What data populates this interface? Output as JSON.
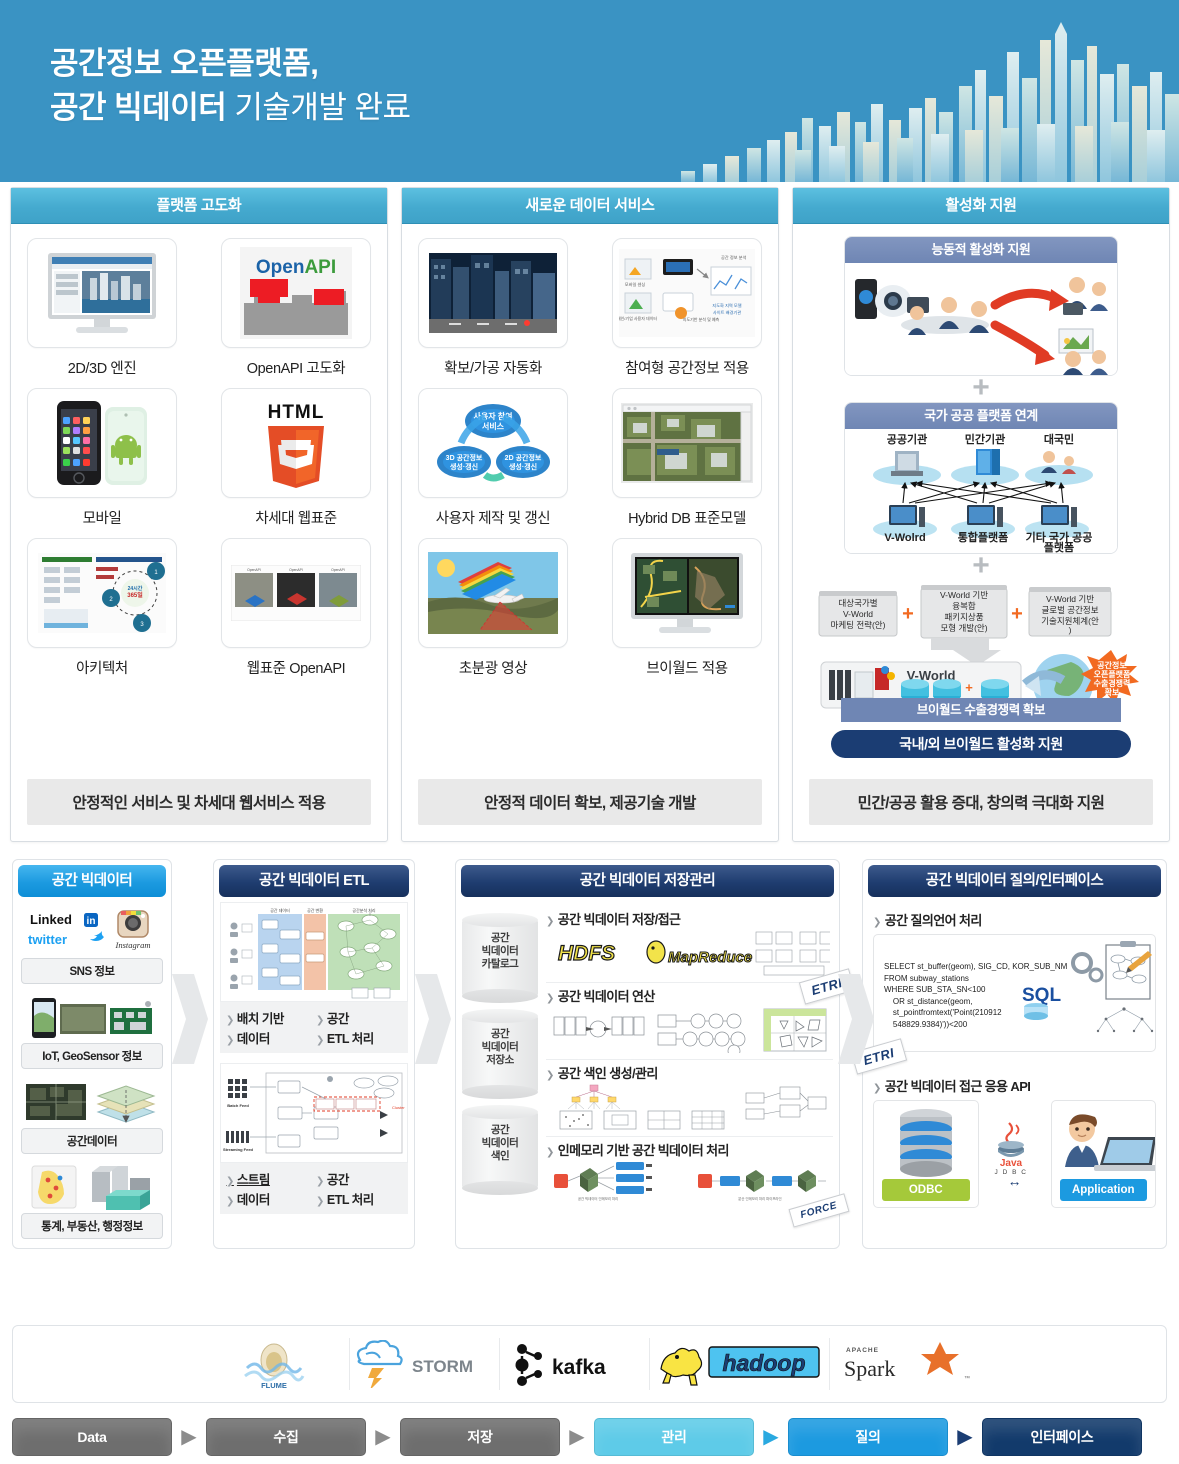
{
  "header": {
    "title_line1": "공간정보 오픈플랫폼,",
    "title_line2_bold": "공간 빅데이터",
    "title_line2_light": " 기술개발 완료",
    "bg_color": "#3a93c3",
    "graphic": "3d-city-skyline"
  },
  "panels": [
    {
      "title": "플랫폼 고도화",
      "tiles": [
        {
          "caption": "2D/3D 엔진",
          "icon": "desktop-monitor-3d-map"
        },
        {
          "caption": "OpenAPI 고도화",
          "icon": "openapi-logo"
        },
        {
          "caption": "모바일",
          "icon": "smartphones-ios-android"
        },
        {
          "caption": "차세대 웹표준",
          "icon": "html5-logo"
        },
        {
          "caption": "아키텍처",
          "icon": "architecture-diagram"
        },
        {
          "caption": "웹표준 OpenAPI",
          "icon": "webstandard-openapi-thumbnails"
        }
      ],
      "footer": "안정적인 서비스 및 차세대 웹서비스 적용"
    },
    {
      "title": "새로운 데이터 서비스",
      "tiles": [
        {
          "caption": "확보/가공 자동화",
          "icon": "city-street-photo"
        },
        {
          "caption": "참여형 공간정보 적용",
          "icon": "participatory-spatial-diagram"
        },
        {
          "caption": "사용자 제작 및 갱신",
          "icon": "cycle-diagram-user-service"
        },
        {
          "caption": "Hybrid DB 표준모델",
          "icon": "aerial-map-viewer"
        },
        {
          "caption": "초분광 영상",
          "icon": "hyperspectral-aircraft"
        },
        {
          "caption": "브이월드 적용",
          "icon": "monitor-vworld-map"
        }
      ],
      "footer": "안정적 데이터 확보, 제공기술 개발"
    },
    {
      "title": "활성화 지원",
      "blocks": [
        {
          "title": "능동적 활성화 지원",
          "icon": "people-meeting-devices"
        },
        {
          "title": "국가 공공 플랫폼 연계",
          "top_nodes": [
            "공공기관",
            "민간기관",
            "대국민"
          ],
          "bottom_nodes": [
            "V-Wolrd",
            "통합플랫폼",
            "기타 국가 공공 플랫폼"
          ]
        }
      ],
      "export_boxes": [
        "대상국가별\nV-World\n마케팅 전략(안)",
        "V-World 기반\n융복합\n패키지상품\n모형 개발(안)",
        "V-World 기반\n글로벌 공간정보\n기술지원체계(안)"
      ],
      "vworld_label": "V-World",
      "burst_text": "공간정보\n오픈플랫폼\n수출경쟁력\n확보",
      "bar_sub": "브이월드 수출경쟁력 확보",
      "bar_main": "국내/외 브이월드 활성화 지원",
      "footer": "민간/공공 활용 증대, 창의력 극대화 지원",
      "plus_symbol": "+"
    }
  ],
  "pipeline": {
    "bigdata": {
      "title": "공간 빅데이터",
      "sources": [
        {
          "label": "SNS 정보",
          "icon": "social-logos-linkedin-twitter-instagram"
        },
        {
          "label": "IoT, GeoSensor 정보",
          "icon": "iot-sensor-devices"
        },
        {
          "label": "공간데이터",
          "icon": "satellite-map-layers"
        },
        {
          "label": "통계, 부동산, 행정정보",
          "icon": "statistics-map-buildings"
        }
      ]
    },
    "etl": {
      "title": "공간 빅데이터 ETL",
      "cards": [
        {
          "icon": "batch-etl-flow-diagram",
          "bullets": [
            "배치 기반",
            "공간",
            "데이터",
            "ETL 처리"
          ]
        },
        {
          "icon": "stream-etl-flow-diagram",
          "bullets": [
            "스트림",
            "공간",
            "데이터",
            "ETL 처리"
          ]
        }
      ]
    },
    "storage": {
      "title": "공간 빅데이터 저장관리",
      "cylinders": [
        "공간\n빅데이터\n카탈로그",
        "공간\n빅데이터\n저장소",
        "공간\n빅데이터\n색인"
      ],
      "features": [
        {
          "title": "공간 빅데이터 저장/접근",
          "icon": "hdfs-mapreduce-logos"
        },
        {
          "title": "공간 빅데이터 연산",
          "icon": "operation-flow-charts"
        },
        {
          "title": "공간 색인 생성/관리",
          "icon": "spatial-index-grids"
        },
        {
          "title": "인메모리 기반 공간 빅데이터 처리",
          "icon": "in-memory-processing-diagram"
        }
      ],
      "stamps": [
        "ETRI",
        "FORCE"
      ]
    },
    "query": {
      "title": "공간 빅데이터 질의/인터페이스",
      "sections": [
        {
          "title": "공간 질의언어 처리",
          "sql": "SELECT st_buffer(geom), SIG_CD, KOR_SUB_NM\nFROM subway_stations\nWHERE SUB_STA_SN<100\n    OR st_distance(geom,\n    st_pointfromtext('Point(210912\n    548829.9384)'))<200",
          "badge": "SQL"
        },
        {
          "title": "공간 빅데이터 접근 응용 API",
          "left_tag": "ODBC",
          "right_tag": "Application",
          "middle_icon": "java-jdbc-logo",
          "middle_label": "Java\nJ D B C"
        }
      ],
      "stamp": "ETRI"
    }
  },
  "logos": [
    {
      "name": "flume-logo",
      "label": "FLUME"
    },
    {
      "name": "storm-logo",
      "label": "STORM"
    },
    {
      "name": "kafka-logo",
      "label": "kafka"
    },
    {
      "name": "hadoop-logo",
      "label": "hadoop"
    },
    {
      "name": "spark-logo",
      "label": "Spark",
      "sublabel": "APACHE"
    }
  ],
  "workflow": [
    {
      "label": "Data",
      "color": "#6e6e6e"
    },
    {
      "label": "수집",
      "color": "#6e6e6e"
    },
    {
      "label": "저장",
      "color": "#6e6e6e"
    },
    {
      "label": "관리",
      "color": "#5ecbe8"
    },
    {
      "label": "질의",
      "color": "#1c9ae0"
    },
    {
      "label": "인터페이스",
      "color": "#123a6b"
    }
  ],
  "workflow_arrow": "▶"
}
